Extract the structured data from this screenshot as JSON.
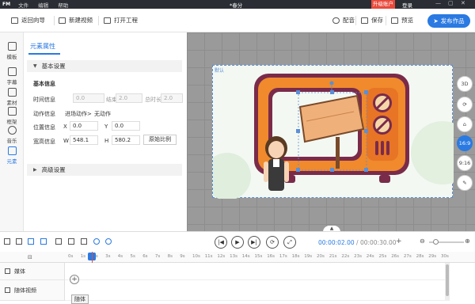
{
  "titlebar": {
    "logo": "FM",
    "menu": [
      "文件",
      "编辑",
      "帮助"
    ],
    "doc_title": "*春分",
    "upgrade_label": "升级账户",
    "login_label": "登录"
  },
  "toolbar": {
    "back_label": "返回向导",
    "new_video_label": "新建视频",
    "open_project_label": "打开工程",
    "dub_label": "配音",
    "save_label": "保存",
    "preview_label": "预览",
    "publish_label": "发布作品"
  },
  "sidebar": {
    "items": [
      {
        "label": "模板",
        "icon": "template-icon"
      },
      {
        "label": "字幕",
        "icon": "subtitle-icon"
      },
      {
        "label": "素材",
        "icon": "material-icon"
      },
      {
        "label": "框架",
        "icon": "frame-icon"
      },
      {
        "label": "音乐",
        "icon": "music-icon"
      },
      {
        "label": "元素",
        "icon": "element-icon"
      }
    ]
  },
  "panel": {
    "tab_label": "元素属性",
    "basic_section": "基本设置",
    "basic_info": "基本信息",
    "time_info": "时间信息",
    "start_time": "0.0",
    "end_label": "结束",
    "end_time": "2.0",
    "duration_label": "总时长",
    "duration": "2.0",
    "action_info": "动作信息",
    "enter_action": "进场动作>",
    "no_action": "无动作",
    "position_info": "位置信息",
    "x_label": "X",
    "x_value": "0.0",
    "y_label": "Y",
    "y_value": "0.0",
    "size_info": "宽高信息",
    "w_label": "W",
    "w_value": "548.1",
    "h_label": "H",
    "h_value": "580.2",
    "ratio_button": "原始比例",
    "advanced_section": "高级设置"
  },
  "canvas": {
    "scene_label": "默认",
    "right_tools": [
      "3D",
      "⟳",
      "⌂",
      "16:9",
      "9:16",
      "✎"
    ],
    "active_ratio": "16:9"
  },
  "timeline": {
    "current_time": "00:00:02.00",
    "total_time": "00:00:30.00",
    "ruler_ticks": [
      "0s",
      "1s",
      "2s",
      "3s",
      "4s",
      "5s",
      "6s",
      "7s",
      "8s",
      "9s",
      "10s",
      "11s",
      "12s",
      "13s",
      "14s",
      "15s",
      "16s",
      "17s",
      "18s",
      "19s",
      "20s",
      "21s",
      "22s",
      "23s",
      "24s",
      "25s",
      "26s",
      "27s",
      "28s",
      "29s",
      "30s"
    ],
    "tracks": [
      {
        "label": "媒体"
      },
      {
        "label": "随体视频"
      }
    ],
    "clip_label": "随体"
  },
  "colors": {
    "accent": "#2a7ae2",
    "upgrade": "#e84a3c",
    "tv_body": "#f08a2c",
    "tv_border": "#7a2b4a"
  }
}
